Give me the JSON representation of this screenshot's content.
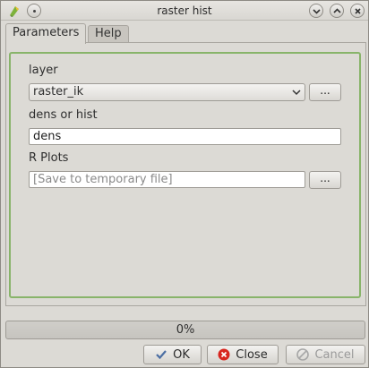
{
  "window": {
    "title": "raster hist"
  },
  "tabs": [
    {
      "label": "Parameters",
      "active": true
    },
    {
      "label": "Help",
      "active": false
    }
  ],
  "form": {
    "layer": {
      "label": "layer",
      "value": "raster_ik",
      "browse_label": "..."
    },
    "dens_or_hist": {
      "label": "dens or hist",
      "value": "dens"
    },
    "r_plots": {
      "label": "R Plots",
      "placeholder": "[Save to temporary file]",
      "browse_label": "..."
    }
  },
  "progress": {
    "text": "0%",
    "value": 0
  },
  "buttons": {
    "ok": "OK",
    "close": "Close",
    "cancel": "Cancel"
  },
  "colors": {
    "group_border": "#88b46a",
    "window_bg": "#dcdad5"
  }
}
